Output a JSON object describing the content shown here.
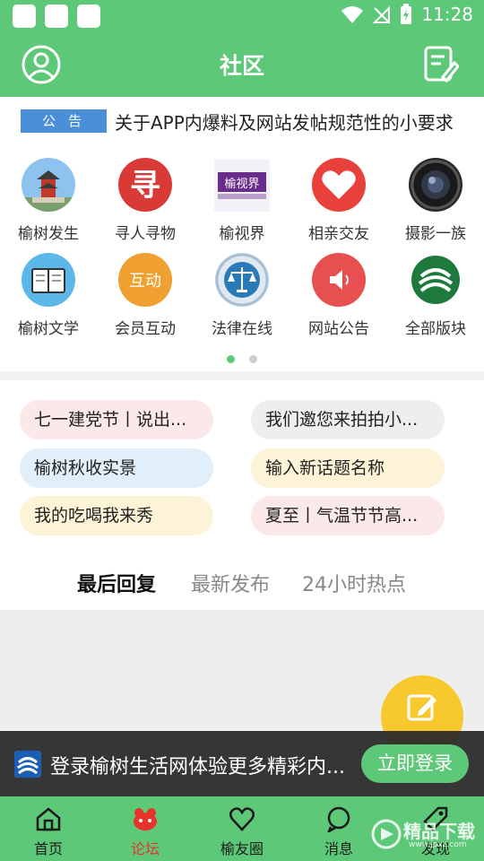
{
  "status_bar": {
    "time": "11:28"
  },
  "header": {
    "title": "社区",
    "avatar_icon": "user-circle-icon",
    "edit_icon": "edit-note-icon"
  },
  "notice": {
    "tag": "公告",
    "text": "关于APP内爆料及网站发帖规范性的小要求"
  },
  "categories": [
    {
      "label": "榆树发生",
      "icon": "pagoda-icon",
      "color": "#6aa8e8"
    },
    {
      "label": "寻人寻物",
      "icon": "seek-icon",
      "color": "#d93a36"
    },
    {
      "label": "榆视界",
      "icon": "yushijie-icon",
      "color": "#6a2c8c",
      "logo_text": "榆视界"
    },
    {
      "label": "相亲交友",
      "icon": "heart-icon",
      "color": "#e8413b"
    },
    {
      "label": "摄影一族",
      "icon": "camera-icon",
      "color": "#333333"
    },
    {
      "label": "榆树文学",
      "icon": "book-icon",
      "color": "#5bb8e8"
    },
    {
      "label": "会员互动",
      "icon": "interact-icon",
      "color": "#f0a030",
      "logo_text": "互动"
    },
    {
      "label": "法律在线",
      "icon": "scales-icon",
      "color": "#2a7ab8"
    },
    {
      "label": "网站公告",
      "icon": "speaker-icon",
      "color": "#e85050"
    },
    {
      "label": "全部版块",
      "icon": "all-boards-icon",
      "color": "#1e7a3c"
    }
  ],
  "pager": {
    "active_index": 0,
    "count": 2
  },
  "topics": [
    {
      "label": "七一建党节丨说出...",
      "color": "#fbe8e8"
    },
    {
      "label": "我们邀您来拍拍小...",
      "color": "#eeeeee"
    },
    {
      "label": "榆树秋收实景",
      "color": "#e1effa"
    },
    {
      "label": "输入新话题名称",
      "color": "#fdf3d6"
    },
    {
      "label": "我的吃喝我来秀",
      "color": "#fdf3d6"
    },
    {
      "label": "夏至丨气温节节高...",
      "color": "#fbe8e8"
    }
  ],
  "tabs": [
    {
      "label": "最后回复",
      "active": true
    },
    {
      "label": "最新发布",
      "active": false
    },
    {
      "label": "24小时热点",
      "active": false
    }
  ],
  "fab": {
    "label": "发帖",
    "icon": "compose-icon"
  },
  "login_bar": {
    "message": "登录榆树生活网体验更多精彩内...",
    "button": "立即登录"
  },
  "bottom_nav": [
    {
      "label": "首页",
      "icon": "home-icon",
      "active": false
    },
    {
      "label": "论坛",
      "icon": "forum-icon",
      "active": true
    },
    {
      "label": "榆友圈",
      "icon": "friends-heart-icon",
      "active": false
    },
    {
      "label": "消息",
      "icon": "message-icon",
      "active": false
    },
    {
      "label": "发现",
      "icon": "discover-icon",
      "active": false
    }
  ],
  "watermark": {
    "text": "精品下载",
    "url": "www.jpxz.com"
  },
  "colors": {
    "brand_green": "#5dc878",
    "active_red": "#e8322c",
    "notice_blue": "#4a90d9",
    "fab_yellow": "#f7c92f"
  }
}
